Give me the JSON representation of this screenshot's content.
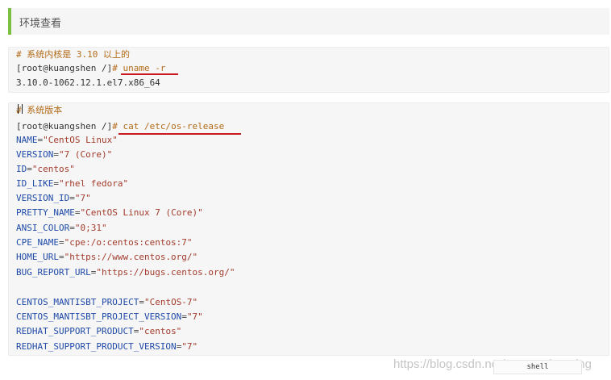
{
  "heading": {
    "text": "环境查看"
  },
  "block1": {
    "comment": "# 系统内核是 3.10 以上的",
    "prompt": "[root@kuangshen /]",
    "command": "# uname -r",
    "output": "3.10.0-1062.12.1.el7.x86_64"
  },
  "block2": {
    "comment": "# 系统版本",
    "prompt": "[root@kuangshen /]",
    "command": "# cat /etc/os-release",
    "lines": [
      {
        "key": "NAME",
        "value": "\"CentOS Linux\""
      },
      {
        "key": "VERSION",
        "value": "\"7 (Core)\""
      },
      {
        "key": "ID",
        "value": "\"centos\""
      },
      {
        "key": "ID_LIKE",
        "value": "\"rhel fedora\""
      },
      {
        "key": "VERSION_ID",
        "value": "\"7\""
      },
      {
        "key": "PRETTY_NAME",
        "value": "\"CentOS Linux 7 (Core)\""
      },
      {
        "key": "ANSI_COLOR",
        "value": "\"0;31\""
      },
      {
        "key": "CPE_NAME",
        "value": "\"cpe:/o:centos:centos:7\""
      },
      {
        "key": "HOME_URL",
        "value": "\"https://www.centos.org/\""
      },
      {
        "key": "BUG_REPORT_URL",
        "value": "\"https://bugs.centos.org/\""
      },
      {
        "key": "CENTOS_MANTISBT_PROJECT",
        "value": "\"CentOS-7\""
      },
      {
        "key": "CENTOS_MANTISBT_PROJECT_VERSION",
        "value": "\"7\""
      },
      {
        "key": "REDHAT_SUPPORT_PRODUCT",
        "value": "\"centos\""
      },
      {
        "key": "REDHAT_SUPPORT_PRODUCT_VERSION",
        "value": "\"7\""
      }
    ],
    "language": "shell"
  },
  "watermark": "https://blog.csdn.net/TYUT_xiaoming",
  "colors": {
    "accent_bar": "#7bc043",
    "underline": "#c8191e",
    "key": "#1f4aa8",
    "string": "#a33c2c",
    "comment": "#b36b19"
  }
}
